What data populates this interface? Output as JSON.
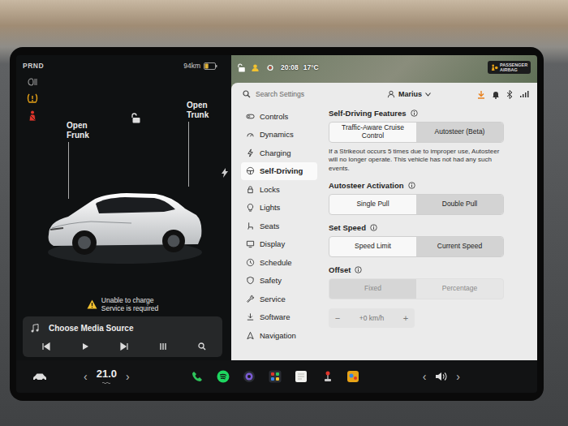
{
  "left_panel": {
    "gear": "PRND",
    "range": "94km",
    "battery_level": 0.35,
    "locked": false,
    "car_controls": [
      {
        "label": "Open Frunk"
      },
      {
        "label": "Open Trunk"
      }
    ],
    "charge_warning": {
      "title": "Unable to charge",
      "subtitle": "Service is required"
    },
    "media": {
      "title": "Choose Media Source"
    }
  },
  "status_bar": {
    "time": "20:08",
    "temperature": "17°C",
    "airbag_badge": "PASSENGER AIRBAG"
  },
  "search": {
    "placeholder": "Search Settings"
  },
  "user": {
    "name": "Marius"
  },
  "sidebar": {
    "items": [
      {
        "label": "Controls",
        "selected": false
      },
      {
        "label": "Dynamics",
        "selected": false
      },
      {
        "label": "Charging",
        "selected": false
      },
      {
        "label": "Self-Driving",
        "selected": true
      },
      {
        "label": "Locks",
        "selected": false
      },
      {
        "label": "Lights",
        "selected": false
      },
      {
        "label": "Seats",
        "selected": false
      },
      {
        "label": "Display",
        "selected": false
      },
      {
        "label": "Schedule",
        "selected": false
      },
      {
        "label": "Safety",
        "selected": false
      },
      {
        "label": "Service",
        "selected": false
      },
      {
        "label": "Software",
        "selected": false
      },
      {
        "label": "Navigation",
        "selected": false
      }
    ]
  },
  "settings": [
    {
      "title": "Self-Driving Features",
      "disabled": false,
      "options": [
        {
          "label": "Traffic-Aware Cruise Control",
          "selected": false
        },
        {
          "label": "Autosteer (Beta)",
          "selected": true
        }
      ],
      "note": "If a Strikeout occurs 5 times due to improper use, Autosteer will no longer operate. This vehicle has not had any such events."
    },
    {
      "title": "Autosteer Activation",
      "disabled": false,
      "options": [
        {
          "label": "Single Pull",
          "selected": false
        },
        {
          "label": "Double Pull",
          "selected": true
        }
      ]
    },
    {
      "title": "Set Speed",
      "disabled": false,
      "options": [
        {
          "label": "Speed Limit",
          "selected": false
        },
        {
          "label": "Current Speed",
          "selected": true
        }
      ]
    },
    {
      "title": "Offset",
      "disabled": true,
      "options": [
        {
          "label": "Fixed",
          "selected": true
        },
        {
          "label": "Percentage",
          "selected": false
        }
      ],
      "stepper": {
        "minus": "−",
        "value": "+0 km/h",
        "plus": "+"
      }
    }
  ],
  "bottom_bar": {
    "temperature": "21.0",
    "temp_left": "‹",
    "temp_right": "›",
    "volume_left": "‹",
    "volume_right": "›"
  }
}
